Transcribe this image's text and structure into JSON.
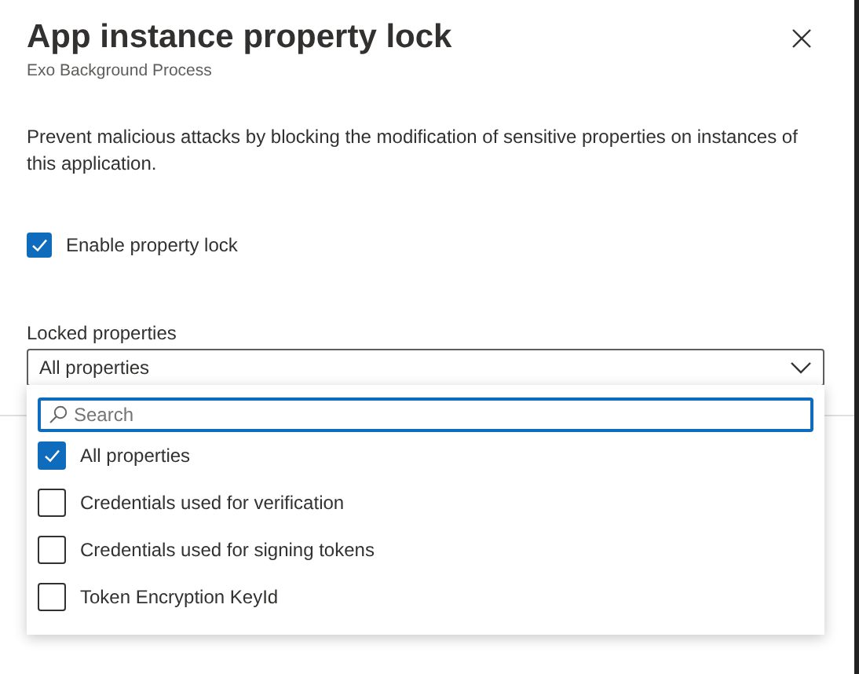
{
  "panel": {
    "title": "App instance property lock",
    "subtitle": "Exo Background Process",
    "description": "Prevent malicious attacks by blocking the modification of sensitive properties on instances of this application."
  },
  "enable_lock": {
    "label": "Enable property lock",
    "checked": true
  },
  "locked_properties": {
    "label": "Locked properties",
    "value": "All properties",
    "expanded": true,
    "search": {
      "placeholder": "Search"
    },
    "options": [
      {
        "label": "All properties",
        "checked": true
      },
      {
        "label": "Credentials used for verification",
        "checked": false
      },
      {
        "label": "Credentials used for signing tokens",
        "checked": false
      },
      {
        "label": "Token Encryption KeyId",
        "checked": false
      }
    ]
  }
}
